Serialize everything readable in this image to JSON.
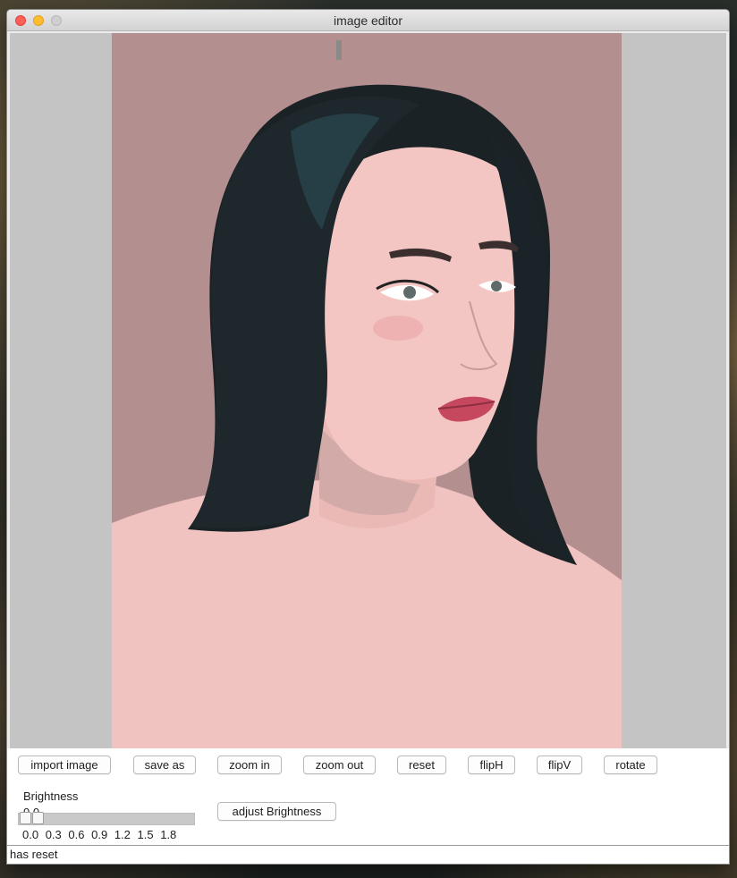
{
  "window": {
    "title": "image editor"
  },
  "toolbar": {
    "buttons": [
      {
        "label": "import image"
      },
      {
        "label": "save as"
      },
      {
        "label": "zoom in"
      },
      {
        "label": "zoom out"
      },
      {
        "label": "reset"
      },
      {
        "label": "flipH"
      },
      {
        "label": "flipV"
      },
      {
        "label": "rotate"
      }
    ]
  },
  "brightness": {
    "label": "Brightness",
    "value": "0.0",
    "ticks": [
      "0.0",
      "0.3",
      "0.6",
      "0.9",
      "1.2",
      "1.5",
      "1.8"
    ],
    "adjust_label": "adjust Brightness"
  },
  "status": {
    "text": "has reset"
  },
  "colors": {
    "photo_background": "#b48f8f",
    "skin": "#f1c3c0",
    "hair": "#1a2124",
    "canvas_background": "#c4c4c4"
  }
}
